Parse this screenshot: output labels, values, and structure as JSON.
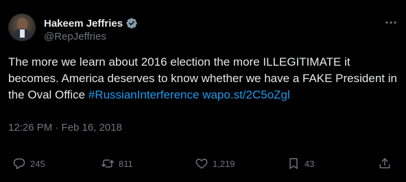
{
  "author": {
    "display_name": "Hakeem Jeffries",
    "handle": "@RepJeffries",
    "verified_icon": "verified-badge-icon",
    "verified_color": "#1d9bf0"
  },
  "tweet": {
    "text": "The more we learn about 2016 election the more ILLEGITIMATE it becomes. America deserves to know whether we have a FAKE President in the Oval Office",
    "hashtag": "#RussianInterference",
    "link": "wapo.st/2C5oZgl",
    "timestamp": "12:26 PM · Feb 16, 2018"
  },
  "actions": {
    "replies": "245",
    "retweets": "811",
    "likes": "1,219",
    "bookmarks": "43"
  },
  "colors": {
    "background": "#000000",
    "text": "#e7e9ea",
    "muted": "#71767b",
    "accent": "#1d9bf0"
  }
}
